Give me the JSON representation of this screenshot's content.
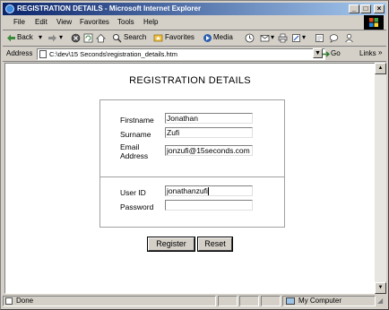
{
  "window": {
    "title": "REGISTRATION DETAILS - Microsoft Internet Explorer",
    "min": "_",
    "max": "□",
    "close": "×"
  },
  "menu": [
    {
      "label": "File"
    },
    {
      "label": "Edit"
    },
    {
      "label": "View"
    },
    {
      "label": "Favorites"
    },
    {
      "label": "Tools"
    },
    {
      "label": "Help"
    }
  ],
  "toolbar": {
    "back": "Back",
    "search": "Search",
    "favorites": "Favorites",
    "media": "Media"
  },
  "address": {
    "label": "Address",
    "value": "C:\\dev\\15 Seconds\\registration_details.htm",
    "go": "Go",
    "links": "Links"
  },
  "page": {
    "title": "REGISTRATION DETAILS",
    "fields": {
      "firstname_label": "Firstname",
      "firstname_value": "Jonathan",
      "surname_label": "Surname",
      "surname_value": "Zufi",
      "email_label_line1": "Email",
      "email_label_line2": "Address",
      "email_value": "jonzufi@15seconds.com",
      "userid_label": "User ID",
      "userid_value": "jonathanzufi",
      "password_label": "Password",
      "password_value": ""
    },
    "register_button": "Register",
    "reset_button": "Reset"
  },
  "status": {
    "text": "Done",
    "zone": "My Computer"
  },
  "colors": {
    "title_start": "#0a246a",
    "title_end": "#a6caf0",
    "chrome": "#d4d0c8"
  }
}
